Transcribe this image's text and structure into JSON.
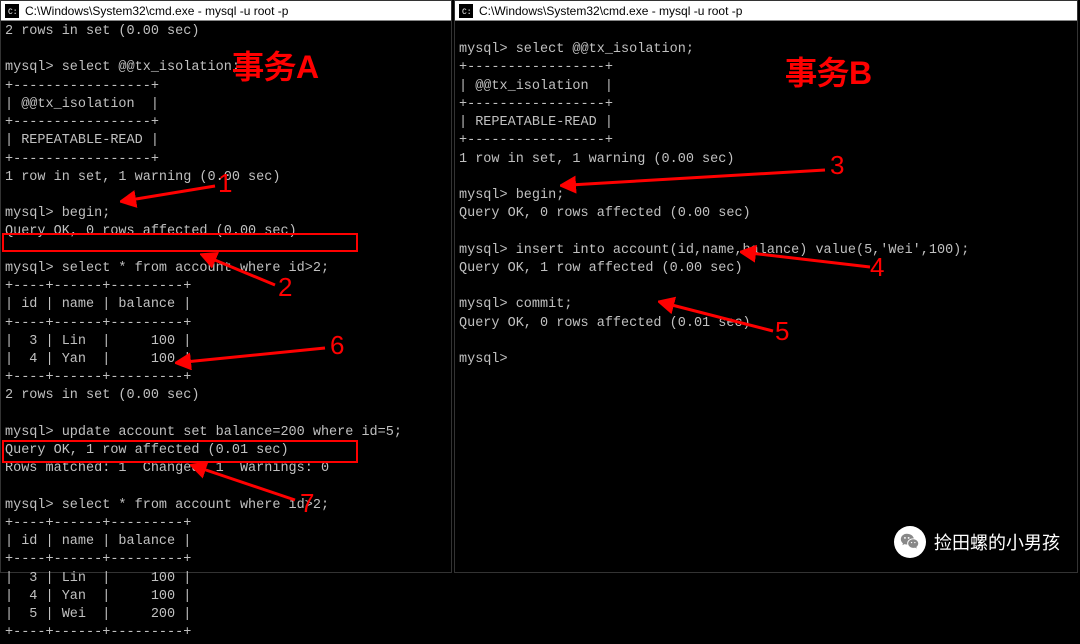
{
  "leftWindow": {
    "title": "C:\\Windows\\System32\\cmd.exe - mysql   -u root -p",
    "lines": [
      "2 rows in set (0.00 sec)",
      "",
      "mysql> select @@tx_isolation;",
      "+-----------------+",
      "| @@tx_isolation  |",
      "+-----------------+",
      "| REPEATABLE-READ |",
      "+-----------------+",
      "1 row in set, 1 warning (0.00 sec)",
      "",
      "mysql> begin;",
      "Query OK, 0 rows affected (0.00 sec)",
      "",
      "mysql> select * from account where id>2;",
      "+----+------+---------+",
      "| id | name | balance |",
      "+----+------+---------+",
      "|  3 | Lin  |     100 |",
      "|  4 | Yan  |     100 |",
      "+----+------+---------+",
      "2 rows in set (0.00 sec)",
      "",
      "mysql> update account set balance=200 where id=5;",
      "Query OK, 1 row affected (0.01 sec)",
      "Rows matched: 1  Changed: 1  Warnings: 0",
      "",
      "mysql> select * from account where id>2;",
      "+----+------+---------+",
      "| id | name | balance |",
      "+----+------+---------+",
      "|  3 | Lin  |     100 |",
      "|  4 | Yan  |     100 |",
      "|  5 | Wei  |     200 |",
      "+----+------+---------+"
    ]
  },
  "rightWindow": {
    "title": "C:\\Windows\\System32\\cmd.exe - mysql   -u root -p",
    "lines": [
      "",
      "mysql> select @@tx_isolation;",
      "+-----------------+",
      "| @@tx_isolation  |",
      "+-----------------+",
      "| REPEATABLE-READ |",
      "+-----------------+",
      "1 row in set, 1 warning (0.00 sec)",
      "",
      "mysql> begin;",
      "Query OK, 0 rows affected (0.00 sec)",
      "",
      "mysql> insert into account(id,name,balance) value(5,'Wei',100);",
      "Query OK, 1 row affected (0.00 sec)",
      "",
      "mysql> commit;",
      "Query OK, 0 rows affected (0.01 sec)",
      "",
      "mysql>"
    ]
  },
  "annotations": {
    "labelA": "事务A",
    "labelB": "事务B",
    "n1": "1",
    "n2": "2",
    "n3": "3",
    "n4": "4",
    "n5": "5",
    "n6": "6",
    "n7": "7"
  },
  "watermark": "捡田螺的小男孩"
}
